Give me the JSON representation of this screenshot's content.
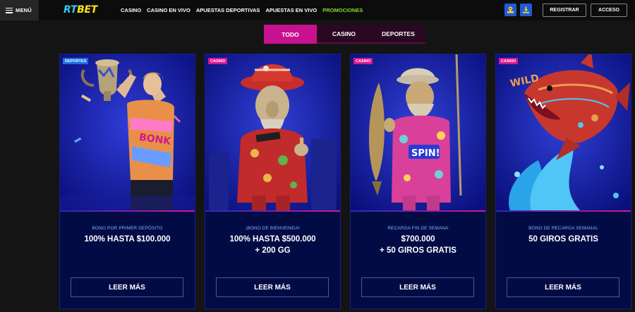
{
  "header": {
    "menu_label": "MENÚ",
    "logo_rt": "RT",
    "logo_bet": "BET",
    "nav": [
      "CASINO",
      "CASINO EN VIVO",
      "APUESTAS DEPORTIVAS",
      "APUESTAS EN VIVO",
      "PROMOCIONES"
    ],
    "register_label": "REGISTRAR",
    "login_label": "ACCESO"
  },
  "filters": [
    "TODO",
    "CASINO",
    "DEPORTES"
  ],
  "cards": [
    {
      "tag": "DEPORTES",
      "subtitle": "BONO POR PRIMER DEPÓSITO",
      "line1": "100% HASTA $100.000",
      "line2": "",
      "button": "LEER MÁS"
    },
    {
      "tag": "CASINO",
      "subtitle": "¡BONO DE BIENVENIDA!",
      "line1": "100% HASTA $500.000",
      "line2": "+ 200 GG",
      "button": "LEER MÁS"
    },
    {
      "tag": "CASINO",
      "subtitle": "RECARGA FIN DE SEMANA",
      "line1": "$700.000",
      "line2": "+ 50 GIROS GRATIS",
      "button": "LEER MÁS"
    },
    {
      "tag": "CASINO",
      "subtitle": "BONO DE RECARGA SEMANAL",
      "line1": "50 GIROS GRATIS",
      "line2": "",
      "button": "LEER MÁS"
    }
  ],
  "art_text": {
    "card1_shirt": "BONK",
    "card3_shirt": "SPIN!",
    "card4_fish": "WILD"
  },
  "colors": {
    "accent_pink": "#c8118e",
    "promo_green": "#87d92f",
    "logo_blue": "#39c7ef",
    "logo_yellow": "#ffe21c",
    "card_bg": "#030b45"
  }
}
